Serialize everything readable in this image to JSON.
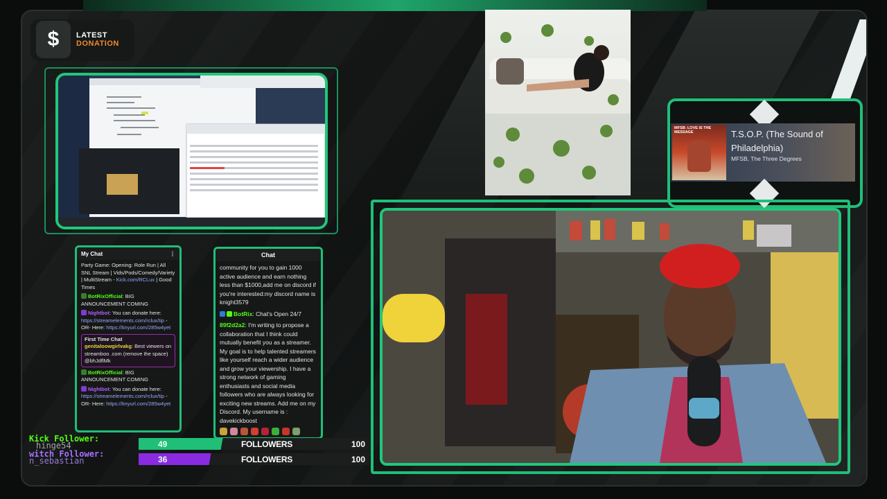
{
  "latest_donation": {
    "line1": "LATEST",
    "line2": "DONATION",
    "icon": "dollar-icon"
  },
  "my_chat": {
    "title": "My Chat",
    "messages": [
      {
        "text": "Party Game: Opening: Role Run | All SNL Stream | Vids/Pods/Comedy/Variety | MultiStream - ",
        "link": "Kick.com/RCLux",
        "suffix": " | Good Times"
      },
      {
        "user": "BotRixOfficial",
        "text": ": BIG ANNOUNCEMENT COMING"
      },
      {
        "user": "Nightbot",
        "text": ": You can donate here: ",
        "link": "https://streamelements.com/rclux/tip",
        "suffix": " -OR- Here: ",
        "link2": "https://tinyurl.com/285w4yet"
      },
      {
        "first_chat_label": "First Time Chat",
        "user": "genitaloowgirlvakg",
        "text": ": Best viewers on streamboo .com (remove the space) @bhJdflMk"
      },
      {
        "user": "BotRixOfficial",
        "text": ": BIG ANNOUNCEMENT COMING"
      },
      {
        "user": "Nightbot",
        "text": ": You can donate here: ",
        "link": "https://streamelements.com/rclux/tip",
        "suffix": " -OR- Here: ",
        "link2": "https://tinyurl.com/285w4yet"
      }
    ]
  },
  "chat": {
    "title": "Chat",
    "messages": [
      {
        "text": "community for you to gain 1000 active audience and earn nothing less than $1000,add me on discord if you're interested:my discord name is knight3579"
      },
      {
        "user": "BotRix",
        "text": ": Chat's Open 24/7"
      },
      {
        "user": "89f2d2a2",
        "text": ": I'm writing to propose a collaboration that I think could mutually benefit you as a streamer. My goal is to help talented streamers like yourself reach a wider audience and grow your viewership. I have a strong network of gaming enthusiasts and social media followers who are always looking for exciting new streams. Add me on my Discord. My username is : davekickboost"
      }
    ]
  },
  "now_playing": {
    "album_text": "MFSB: LOVE IS THE MESSAGE",
    "track": "T.S.O.P. (The Sound of Philadelphia)",
    "artist": "MFSB, The Three Degrees"
  },
  "followers": {
    "kick_label": "Kick Follower:",
    "kick_latest": "hinge54",
    "twitch_label": "witch Follower:",
    "twitch_latest": "n_sebastian",
    "kick_bar": {
      "count": "49",
      "label": "FOLLOWERS",
      "goal": "100",
      "fraction": 0.42,
      "color": "#1fbf77"
    },
    "twitch_bar": {
      "count": "36",
      "label": "FOLLOWERS",
      "goal": "100",
      "fraction": 0.36,
      "color": "#8a2be2"
    }
  }
}
